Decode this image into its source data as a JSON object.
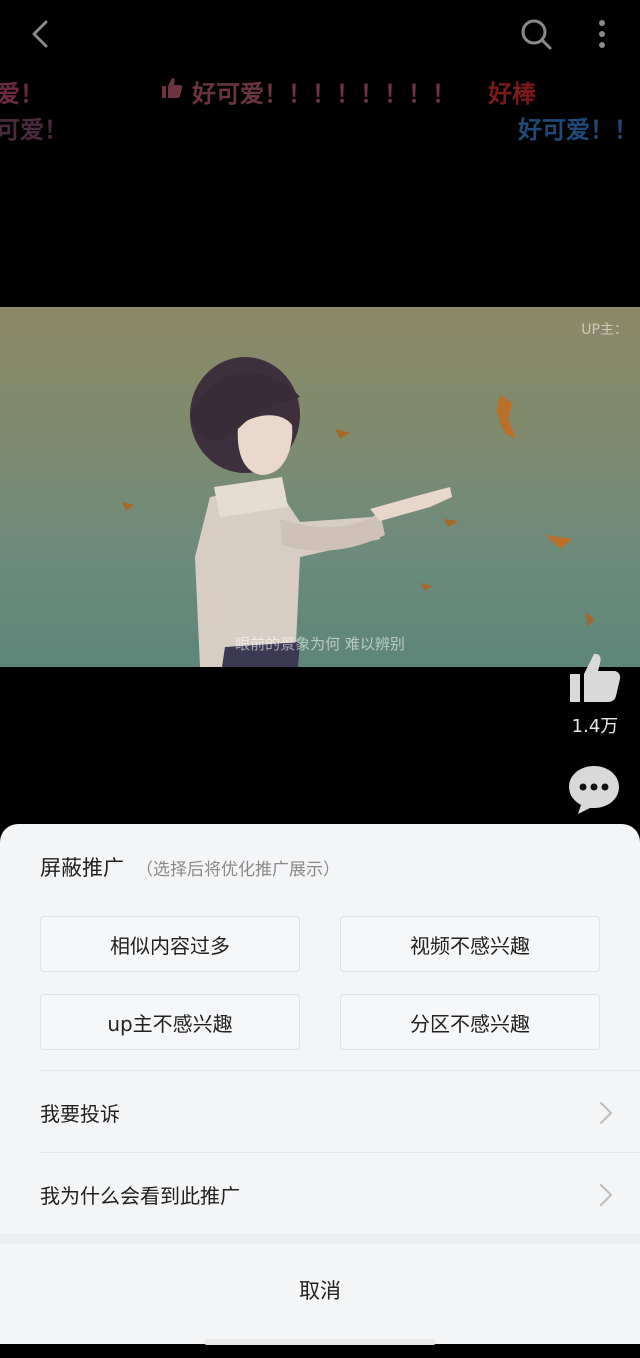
{
  "danmaku": [
    {
      "text": "爱！",
      "color": "#6a2a3f"
    },
    {
      "text": "好可爱！！！！！！！！",
      "color": "#6b3440"
    },
    {
      "text": "好棒",
      "color": "#7a1a1a"
    },
    {
      "text": "可爱！",
      "color": "#4a2a3f"
    },
    {
      "text": "好可爱！！",
      "color": "#1f4a78"
    }
  ],
  "video": {
    "watermark": "UP主：",
    "subtitle": "眼前的景象为何 难以辨别"
  },
  "side": {
    "like_count": "1.4万"
  },
  "sheet": {
    "title": "屏蔽推广",
    "hint": "（选择后将优化推广展示）",
    "options": [
      "相似内容过多",
      "视频不感兴趣",
      "up主不感兴趣",
      "分区不感兴趣"
    ],
    "report_label": "我要投诉",
    "why_label": "我为什么会看到此推广",
    "cancel_label": "取消"
  },
  "colors": {
    "sheet_bg": "#f4f5f7",
    "accent_red": "#7a1a1a"
  }
}
